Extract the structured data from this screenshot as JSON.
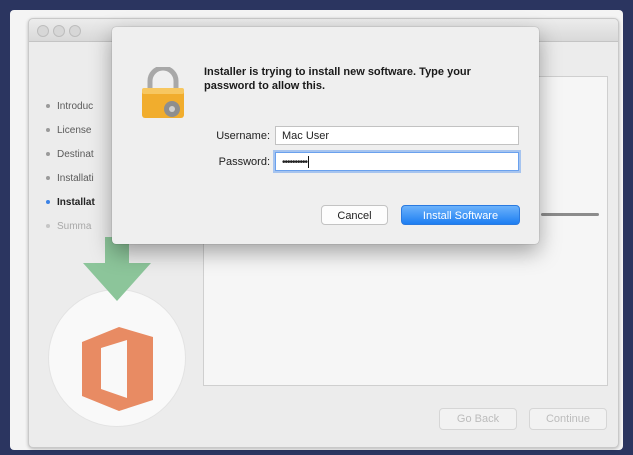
{
  "installer": {
    "sidebar": {
      "items": [
        {
          "label": "Introduc"
        },
        {
          "label": "License"
        },
        {
          "label": "Destinat"
        },
        {
          "label": "Installati"
        },
        {
          "label": "Installat"
        },
        {
          "label": "Summa"
        }
      ]
    },
    "buttons": {
      "go_back": "Go Back",
      "continue": "Continue"
    }
  },
  "dialog": {
    "message": "Installer is trying to install new software. Type your password to allow this.",
    "username_label": "Username:",
    "username_value": "Mac User",
    "password_label": "Password:",
    "password_value": "••••••••••",
    "cancel_label": "Cancel",
    "install_label": "Install Software"
  },
  "colors": {
    "background": "#2b3560",
    "accent": "#1d7ef2",
    "office_logo": "#e88b63",
    "download_arrow": "#8cc59a"
  },
  "icons": {
    "dialog": "padlock-icon",
    "logo": "office-logo-icon",
    "arrow": "download-arrow-icon"
  }
}
